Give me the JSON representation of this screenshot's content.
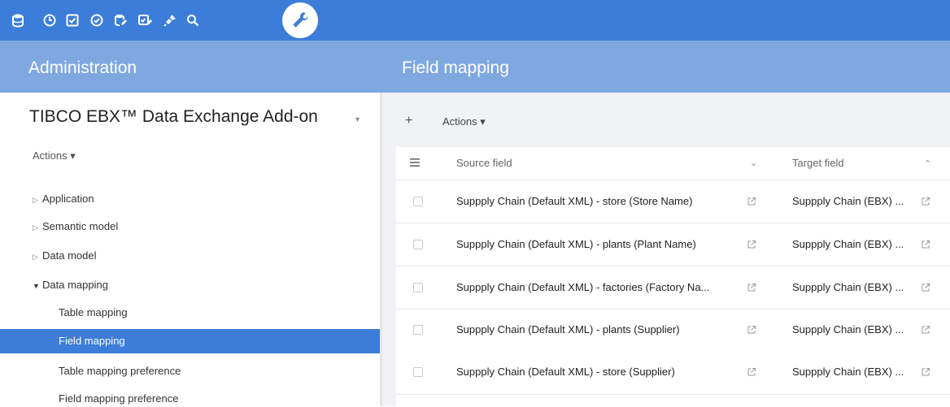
{
  "topbar": {
    "icons": [
      "database-icon",
      "clock-icon",
      "checkbox-icon",
      "check-circle-icon",
      "database-edit-icon",
      "checkbox-edit-icon",
      "plug-icon",
      "search-icon"
    ],
    "active_icon": "wrench-icon"
  },
  "header": {
    "left_title": "Administration",
    "right_title": "Field mapping"
  },
  "left": {
    "workspace_title": "TIBCO EBX™ Data Exchange Add-on",
    "actions_label": "Actions ▾",
    "tree": [
      {
        "label": "Application",
        "level": 0,
        "state": "collapsed"
      },
      {
        "label": "Semantic model",
        "level": 0,
        "state": "collapsed"
      },
      {
        "label": "Data model",
        "level": 0,
        "state": "collapsed"
      },
      {
        "label": "Data mapping",
        "level": 0,
        "state": "expanded"
      },
      {
        "label": "Table mapping",
        "level": 1,
        "state": "leaf"
      },
      {
        "label": "Field mapping",
        "level": 1,
        "state": "selected"
      },
      {
        "label": "Table mapping preference",
        "level": 1,
        "state": "leaf"
      },
      {
        "label": "Field mapping preference",
        "level": 1,
        "state": "leaf"
      }
    ]
  },
  "main": {
    "add_label": "+",
    "actions_label": "Actions ▾",
    "columns": {
      "source": "Source field",
      "target": "Target field"
    },
    "rows": [
      {
        "source": "Suppply Chain (Default XML) - store (Store Name)",
        "target": "Suppply Chain (EBX) ..."
      },
      {
        "source": "Suppply Chain (Default XML) - plants (Plant Name)",
        "target": "Suppply Chain (EBX) ..."
      },
      {
        "source": "Suppply Chain (Default XML) - factories (Factory Na...",
        "target": "Suppply Chain (EBX) ..."
      },
      {
        "source": "Suppply Chain (Default XML) - plants (Supplier)",
        "target": "Suppply Chain (EBX) ..."
      },
      {
        "source": "Suppply Chain (Default XML) - store (Supplier)",
        "target": "Suppply Chain (EBX) ..."
      }
    ]
  },
  "colors": {
    "topbar": "#3b7dd8",
    "header": "#7fa8e0",
    "selection": "#3b7dd8"
  }
}
